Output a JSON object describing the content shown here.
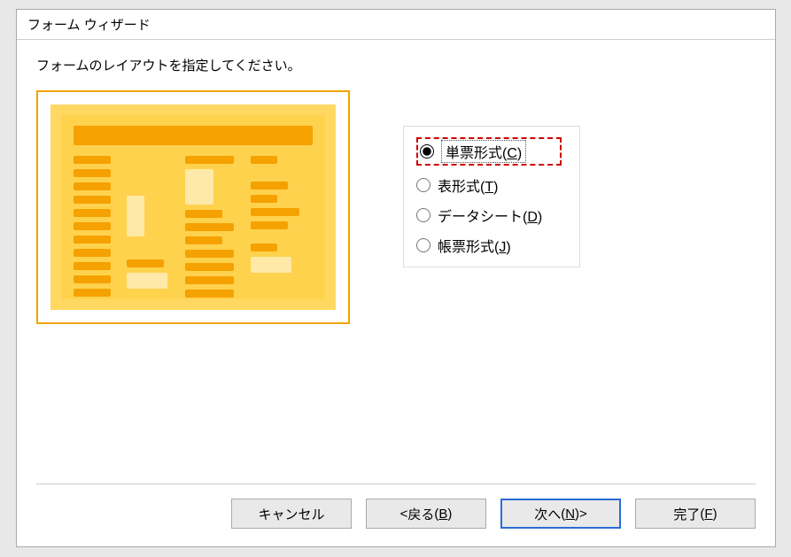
{
  "dialog": {
    "title": "フォーム ウィザード",
    "instruction": "フォームのレイアウトを指定してください。"
  },
  "layout_options": {
    "columnar": {
      "label": "単票形式",
      "key": "C",
      "checked": true,
      "highlighted": true
    },
    "tabular": {
      "label": "表形式",
      "key": "T",
      "checked": false
    },
    "datasheet": {
      "label": "データシート",
      "key": "D",
      "checked": false
    },
    "justified": {
      "label": "帳票形式",
      "key": "J",
      "checked": false
    }
  },
  "buttons": {
    "cancel": {
      "label": "キャンセル"
    },
    "back": {
      "label": "戻る",
      "key": "B",
      "prefix": "< "
    },
    "next": {
      "label": "次へ",
      "key": "N",
      "suffix": " >"
    },
    "finish": {
      "label": "完了",
      "key": "F"
    }
  }
}
